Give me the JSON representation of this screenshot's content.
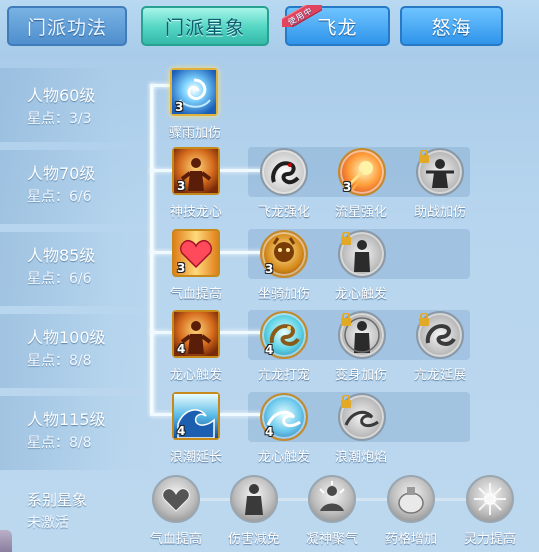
{
  "tabs": {
    "school_skill": "门派功法",
    "school_star": "门派星象",
    "feilong": "飞龙",
    "feilong_badge": "使用中",
    "nuhai": "怒海"
  },
  "tiers": [
    {
      "title": "人物60级",
      "points": "星点：3/3"
    },
    {
      "title": "人物70级",
      "points": "星点：6/6"
    },
    {
      "title": "人物85级",
      "points": "星点：6/6"
    },
    {
      "title": "人物100级",
      "points": "星点：8/8"
    },
    {
      "title": "人物115级",
      "points": "星点：8/8"
    }
  ],
  "nodes": {
    "row1": [
      {
        "label": "骤雨加伤",
        "count": "3"
      }
    ],
    "row2": [
      {
        "label": "神技龙心",
        "count": "3"
      },
      {
        "label": "飞龙强化",
        "count": ""
      },
      {
        "label": "流星强化",
        "count": "3"
      },
      {
        "label": "助战加伤",
        "count": ""
      }
    ],
    "row3": [
      {
        "label": "气血提高",
        "count": "3"
      },
      {
        "label": "坐骑加伤",
        "count": "3"
      },
      {
        "label": "龙心触发",
        "count": ""
      }
    ],
    "row4": [
      {
        "label": "龙心触发",
        "count": "4"
      },
      {
        "label": "亢龙打宠",
        "count": "4"
      },
      {
        "label": "变身加伤",
        "count": ""
      },
      {
        "label": "亢龙延展",
        "count": ""
      }
    ],
    "row5": [
      {
        "label": "浪潮延长",
        "count": "4"
      },
      {
        "label": "龙心触发",
        "count": "4"
      },
      {
        "label": "浪潮炮焰",
        "count": ""
      }
    ]
  },
  "system": {
    "title": "系别星象",
    "status": "未激活",
    "items": [
      "气血提高",
      "伤害减免",
      "凝神聚气",
      "药格增加",
      "灵力提高"
    ]
  },
  "colors": {
    "background": "#b7d5ee",
    "tab_active": "#52d5c2",
    "tab_blue": "#2f94ea",
    "badge": "#e0445f"
  }
}
